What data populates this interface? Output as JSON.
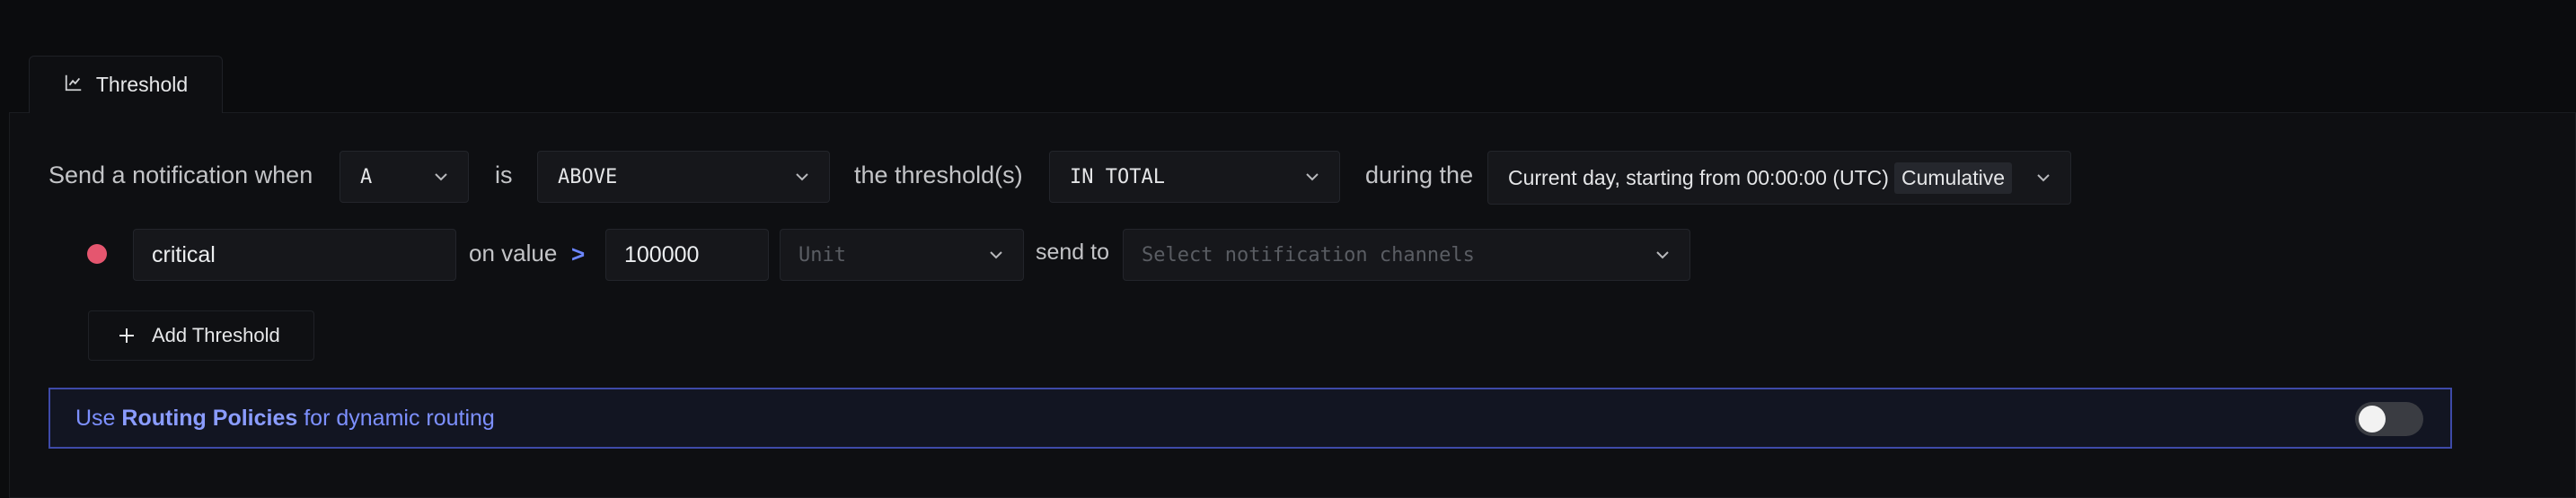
{
  "tab": {
    "label": "Threshold",
    "icon": "line-chart-icon"
  },
  "condition": {
    "prefix": "Send a notification when",
    "query": "A",
    "is_label": "is",
    "operator": "ABOVE",
    "threshold_label": "the threshold(s)",
    "match_type": "IN TOTAL",
    "during_label": "during the",
    "window": "Current day, starting from 00:00:00 (UTC)",
    "window_tag": "Cumulative"
  },
  "threshold": {
    "name": "critical",
    "color": "#e5566f",
    "on_value_label": "on value",
    "op_symbol": ">",
    "value": "100000",
    "unit_placeholder": "Unit",
    "send_to_label": "send to",
    "channels_placeholder": "Select notification channels"
  },
  "add_button": {
    "label": "Add Threshold"
  },
  "routing": {
    "prefix": "Use",
    "link": "Routing Policies",
    "suffix": "for dynamic routing",
    "enabled": false
  },
  "colors": {
    "accent": "#6c86ff",
    "background": "#0b0c0e",
    "banner_border": "#3e4aa8"
  }
}
